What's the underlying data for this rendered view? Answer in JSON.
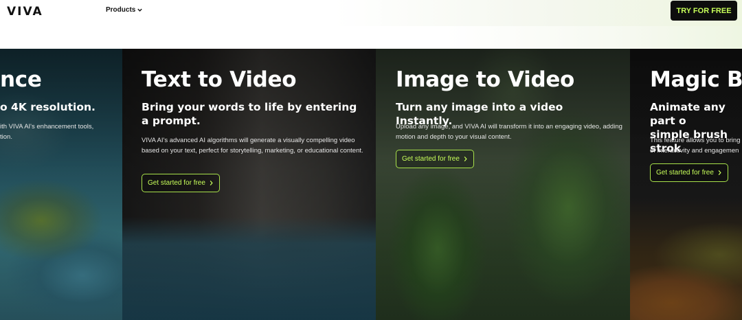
{
  "header": {
    "logo": "VIVA",
    "nav": {
      "products_label": "Products",
      "products_icon": "chevron-down-icon"
    },
    "cta_label": "TRY FOR FREE",
    "cta_text_color": "#c8ff5a"
  },
  "cards": [
    {
      "title": "nce",
      "subtitle": "o 4K resolution.",
      "description_lines": [
        "ith VIVA AI's enhancement tools,",
        "tion."
      ]
    },
    {
      "title": "Text to Video",
      "subtitle": "Bring your words to life by entering a prompt.",
      "description": "VIVA AI's advanced AI algorithms will generate a visually compelling video based on your text, perfect for storytelling, marketing, or educational content.",
      "button_label": "Get started for free"
    },
    {
      "title": "Image to Video",
      "subtitle": "Turn any image into a video Instantly.",
      "description": "Upload any image, and VIVA AI will transform it into an engaging video, adding motion and depth to your visual content.",
      "button_label": "Get started for free"
    },
    {
      "title": "Magic Bru",
      "subtitle_lines": [
        "Animate any part o",
        "simple brush strok"
      ],
      "description_lines": [
        "This feature allows you to bring",
        "of interactivity and engagemen"
      ],
      "button_label": "Get started for free"
    }
  ],
  "accent_color": "#a9e34b"
}
